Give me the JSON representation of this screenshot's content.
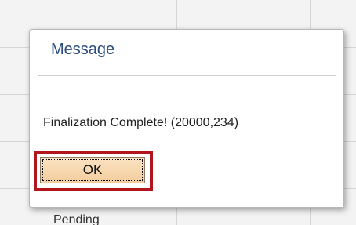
{
  "dialog": {
    "title": "Message",
    "message": "Finalization Complete! (20000,234)",
    "ok_label": "OK"
  },
  "background": {
    "status_text": "Pending"
  },
  "colors": {
    "title": "#2b4c7e",
    "highlight": "#b0161c",
    "button_fill": "#f3cd9c"
  }
}
